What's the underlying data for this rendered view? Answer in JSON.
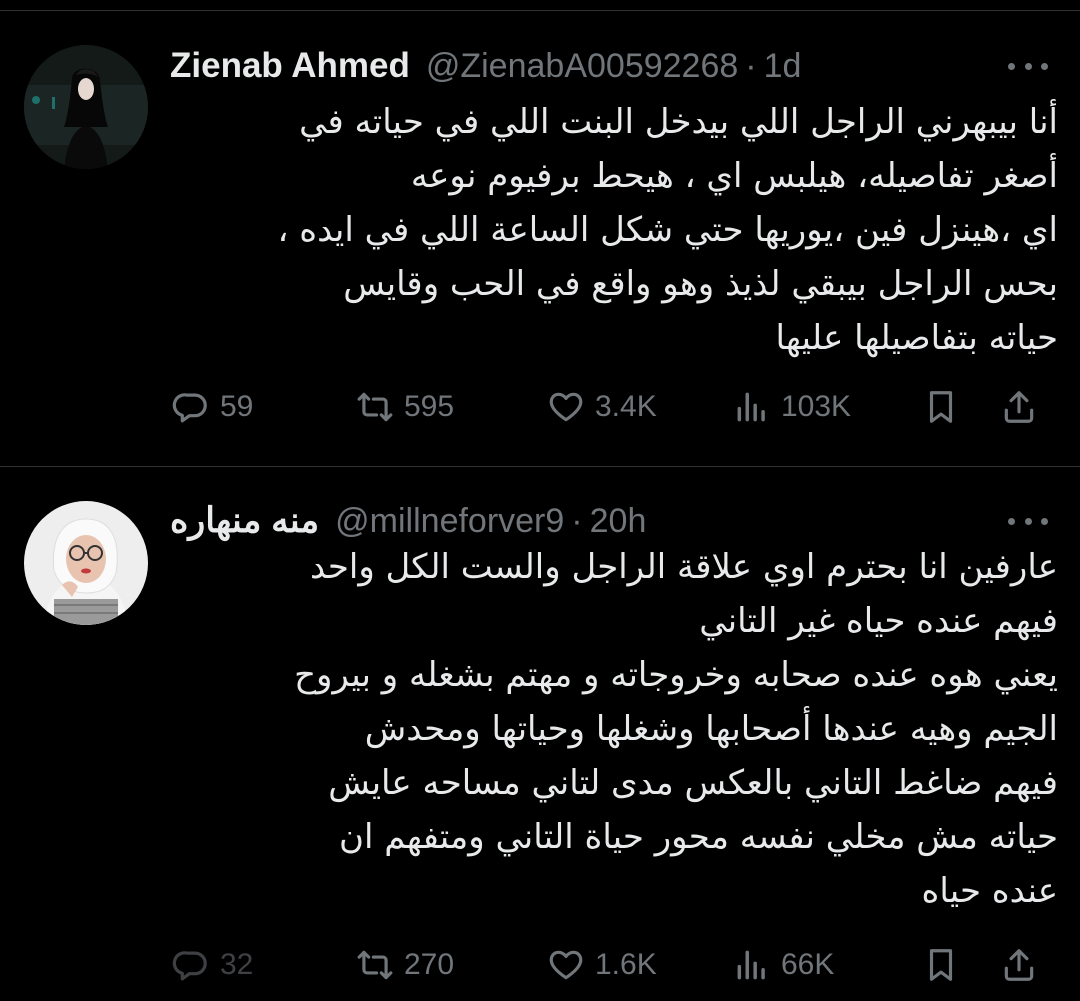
{
  "tweets": [
    {
      "display_name": "Zienab Ahmed",
      "handle": "@ZienabA00592268",
      "separator": "·",
      "time": "1d",
      "text_lines": [
        "أنا بيبهرني الراجل اللي بيدخل البنت اللي في حياته في",
        "أصغر تفاصيله، هيلبس اي ، هيحط برفيوم نوعه",
        "اي ،هينزل فين ،يوريها حتي شكل الساعة اللي في ايده ،",
        "بحس الراجل بيبقي لذيذ وهو واقع في الحب وقايس",
        "حياته بتفاصيلها عليها"
      ],
      "stats": {
        "replies": "59",
        "retweets": "595",
        "likes": "3.4K",
        "views": "103K"
      },
      "icons": {
        "reply": "reply-icon",
        "retweet": "retweet-icon",
        "like": "heart-icon",
        "views": "views-icon",
        "bookmark": "bookmark-icon",
        "share": "share-icon",
        "more": "more-icon"
      }
    },
    {
      "display_name": "منه منهاره",
      "handle": "@millneforver9",
      "separator": "·",
      "time": "20h",
      "text_lines": [
        "عارفين انا بحترم اوي علاقة الراجل والست الكل واحد",
        "فيهم عنده حياه غير التاني",
        "يعني هوه عنده صحابه وخروجاته و مهتم بشغله و بيروح",
        "الجيم وهيه عندها أصحابها وشغلها وحياتها ومحدش",
        "فيهم ضاغط التاني بالعكس مدى لتاني مساحه عايش",
        "حياته مش مخلي نفسه محور حياة التاني ومتفهم ان",
        "عنده حياه"
      ],
      "stats": {
        "replies": "32",
        "retweets": "270",
        "likes": "1.6K",
        "views": "66K"
      },
      "icons": {
        "reply": "reply-icon",
        "retweet": "retweet-icon",
        "like": "heart-icon",
        "views": "views-icon",
        "bookmark": "bookmark-icon",
        "share": "share-icon",
        "more": "more-icon"
      }
    }
  ],
  "colors": {
    "background": "#000000",
    "text": "#e7e9ea",
    "secondary": "#71767b",
    "divider": "#2f3336"
  }
}
